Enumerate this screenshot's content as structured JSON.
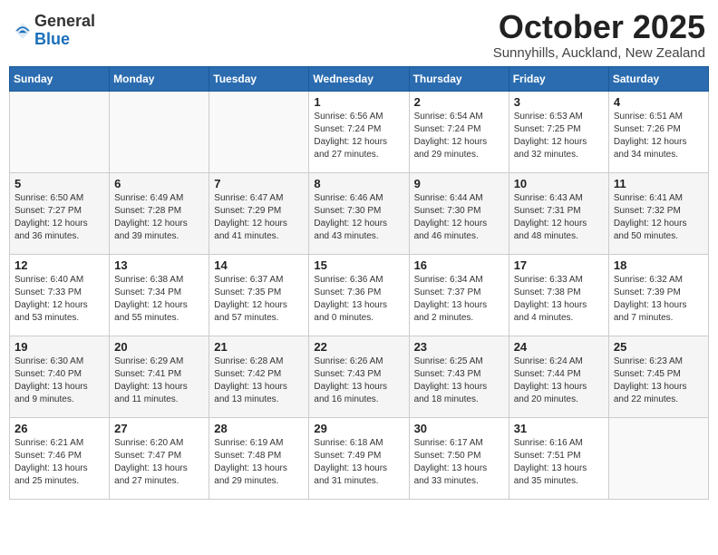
{
  "logo": {
    "general": "General",
    "blue": "Blue"
  },
  "title": "October 2025",
  "location": "Sunnyhills, Auckland, New Zealand",
  "days_of_week": [
    "Sunday",
    "Monday",
    "Tuesday",
    "Wednesday",
    "Thursday",
    "Friday",
    "Saturday"
  ],
  "weeks": [
    [
      {
        "day": "",
        "info": ""
      },
      {
        "day": "",
        "info": ""
      },
      {
        "day": "",
        "info": ""
      },
      {
        "day": "1",
        "info": "Sunrise: 6:56 AM\nSunset: 7:24 PM\nDaylight: 12 hours\nand 27 minutes."
      },
      {
        "day": "2",
        "info": "Sunrise: 6:54 AM\nSunset: 7:24 PM\nDaylight: 12 hours\nand 29 minutes."
      },
      {
        "day": "3",
        "info": "Sunrise: 6:53 AM\nSunset: 7:25 PM\nDaylight: 12 hours\nand 32 minutes."
      },
      {
        "day": "4",
        "info": "Sunrise: 6:51 AM\nSunset: 7:26 PM\nDaylight: 12 hours\nand 34 minutes."
      }
    ],
    [
      {
        "day": "5",
        "info": "Sunrise: 6:50 AM\nSunset: 7:27 PM\nDaylight: 12 hours\nand 36 minutes."
      },
      {
        "day": "6",
        "info": "Sunrise: 6:49 AM\nSunset: 7:28 PM\nDaylight: 12 hours\nand 39 minutes."
      },
      {
        "day": "7",
        "info": "Sunrise: 6:47 AM\nSunset: 7:29 PM\nDaylight: 12 hours\nand 41 minutes."
      },
      {
        "day": "8",
        "info": "Sunrise: 6:46 AM\nSunset: 7:30 PM\nDaylight: 12 hours\nand 43 minutes."
      },
      {
        "day": "9",
        "info": "Sunrise: 6:44 AM\nSunset: 7:30 PM\nDaylight: 12 hours\nand 46 minutes."
      },
      {
        "day": "10",
        "info": "Sunrise: 6:43 AM\nSunset: 7:31 PM\nDaylight: 12 hours\nand 48 minutes."
      },
      {
        "day": "11",
        "info": "Sunrise: 6:41 AM\nSunset: 7:32 PM\nDaylight: 12 hours\nand 50 minutes."
      }
    ],
    [
      {
        "day": "12",
        "info": "Sunrise: 6:40 AM\nSunset: 7:33 PM\nDaylight: 12 hours\nand 53 minutes."
      },
      {
        "day": "13",
        "info": "Sunrise: 6:38 AM\nSunset: 7:34 PM\nDaylight: 12 hours\nand 55 minutes."
      },
      {
        "day": "14",
        "info": "Sunrise: 6:37 AM\nSunset: 7:35 PM\nDaylight: 12 hours\nand 57 minutes."
      },
      {
        "day": "15",
        "info": "Sunrise: 6:36 AM\nSunset: 7:36 PM\nDaylight: 13 hours\nand 0 minutes."
      },
      {
        "day": "16",
        "info": "Sunrise: 6:34 AM\nSunset: 7:37 PM\nDaylight: 13 hours\nand 2 minutes."
      },
      {
        "day": "17",
        "info": "Sunrise: 6:33 AM\nSunset: 7:38 PM\nDaylight: 13 hours\nand 4 minutes."
      },
      {
        "day": "18",
        "info": "Sunrise: 6:32 AM\nSunset: 7:39 PM\nDaylight: 13 hours\nand 7 minutes."
      }
    ],
    [
      {
        "day": "19",
        "info": "Sunrise: 6:30 AM\nSunset: 7:40 PM\nDaylight: 13 hours\nand 9 minutes."
      },
      {
        "day": "20",
        "info": "Sunrise: 6:29 AM\nSunset: 7:41 PM\nDaylight: 13 hours\nand 11 minutes."
      },
      {
        "day": "21",
        "info": "Sunrise: 6:28 AM\nSunset: 7:42 PM\nDaylight: 13 hours\nand 13 minutes."
      },
      {
        "day": "22",
        "info": "Sunrise: 6:26 AM\nSunset: 7:43 PM\nDaylight: 13 hours\nand 16 minutes."
      },
      {
        "day": "23",
        "info": "Sunrise: 6:25 AM\nSunset: 7:43 PM\nDaylight: 13 hours\nand 18 minutes."
      },
      {
        "day": "24",
        "info": "Sunrise: 6:24 AM\nSunset: 7:44 PM\nDaylight: 13 hours\nand 20 minutes."
      },
      {
        "day": "25",
        "info": "Sunrise: 6:23 AM\nSunset: 7:45 PM\nDaylight: 13 hours\nand 22 minutes."
      }
    ],
    [
      {
        "day": "26",
        "info": "Sunrise: 6:21 AM\nSunset: 7:46 PM\nDaylight: 13 hours\nand 25 minutes."
      },
      {
        "day": "27",
        "info": "Sunrise: 6:20 AM\nSunset: 7:47 PM\nDaylight: 13 hours\nand 27 minutes."
      },
      {
        "day": "28",
        "info": "Sunrise: 6:19 AM\nSunset: 7:48 PM\nDaylight: 13 hours\nand 29 minutes."
      },
      {
        "day": "29",
        "info": "Sunrise: 6:18 AM\nSunset: 7:49 PM\nDaylight: 13 hours\nand 31 minutes."
      },
      {
        "day": "30",
        "info": "Sunrise: 6:17 AM\nSunset: 7:50 PM\nDaylight: 13 hours\nand 33 minutes."
      },
      {
        "day": "31",
        "info": "Sunrise: 6:16 AM\nSunset: 7:51 PM\nDaylight: 13 hours\nand 35 minutes."
      },
      {
        "day": "",
        "info": ""
      }
    ]
  ]
}
